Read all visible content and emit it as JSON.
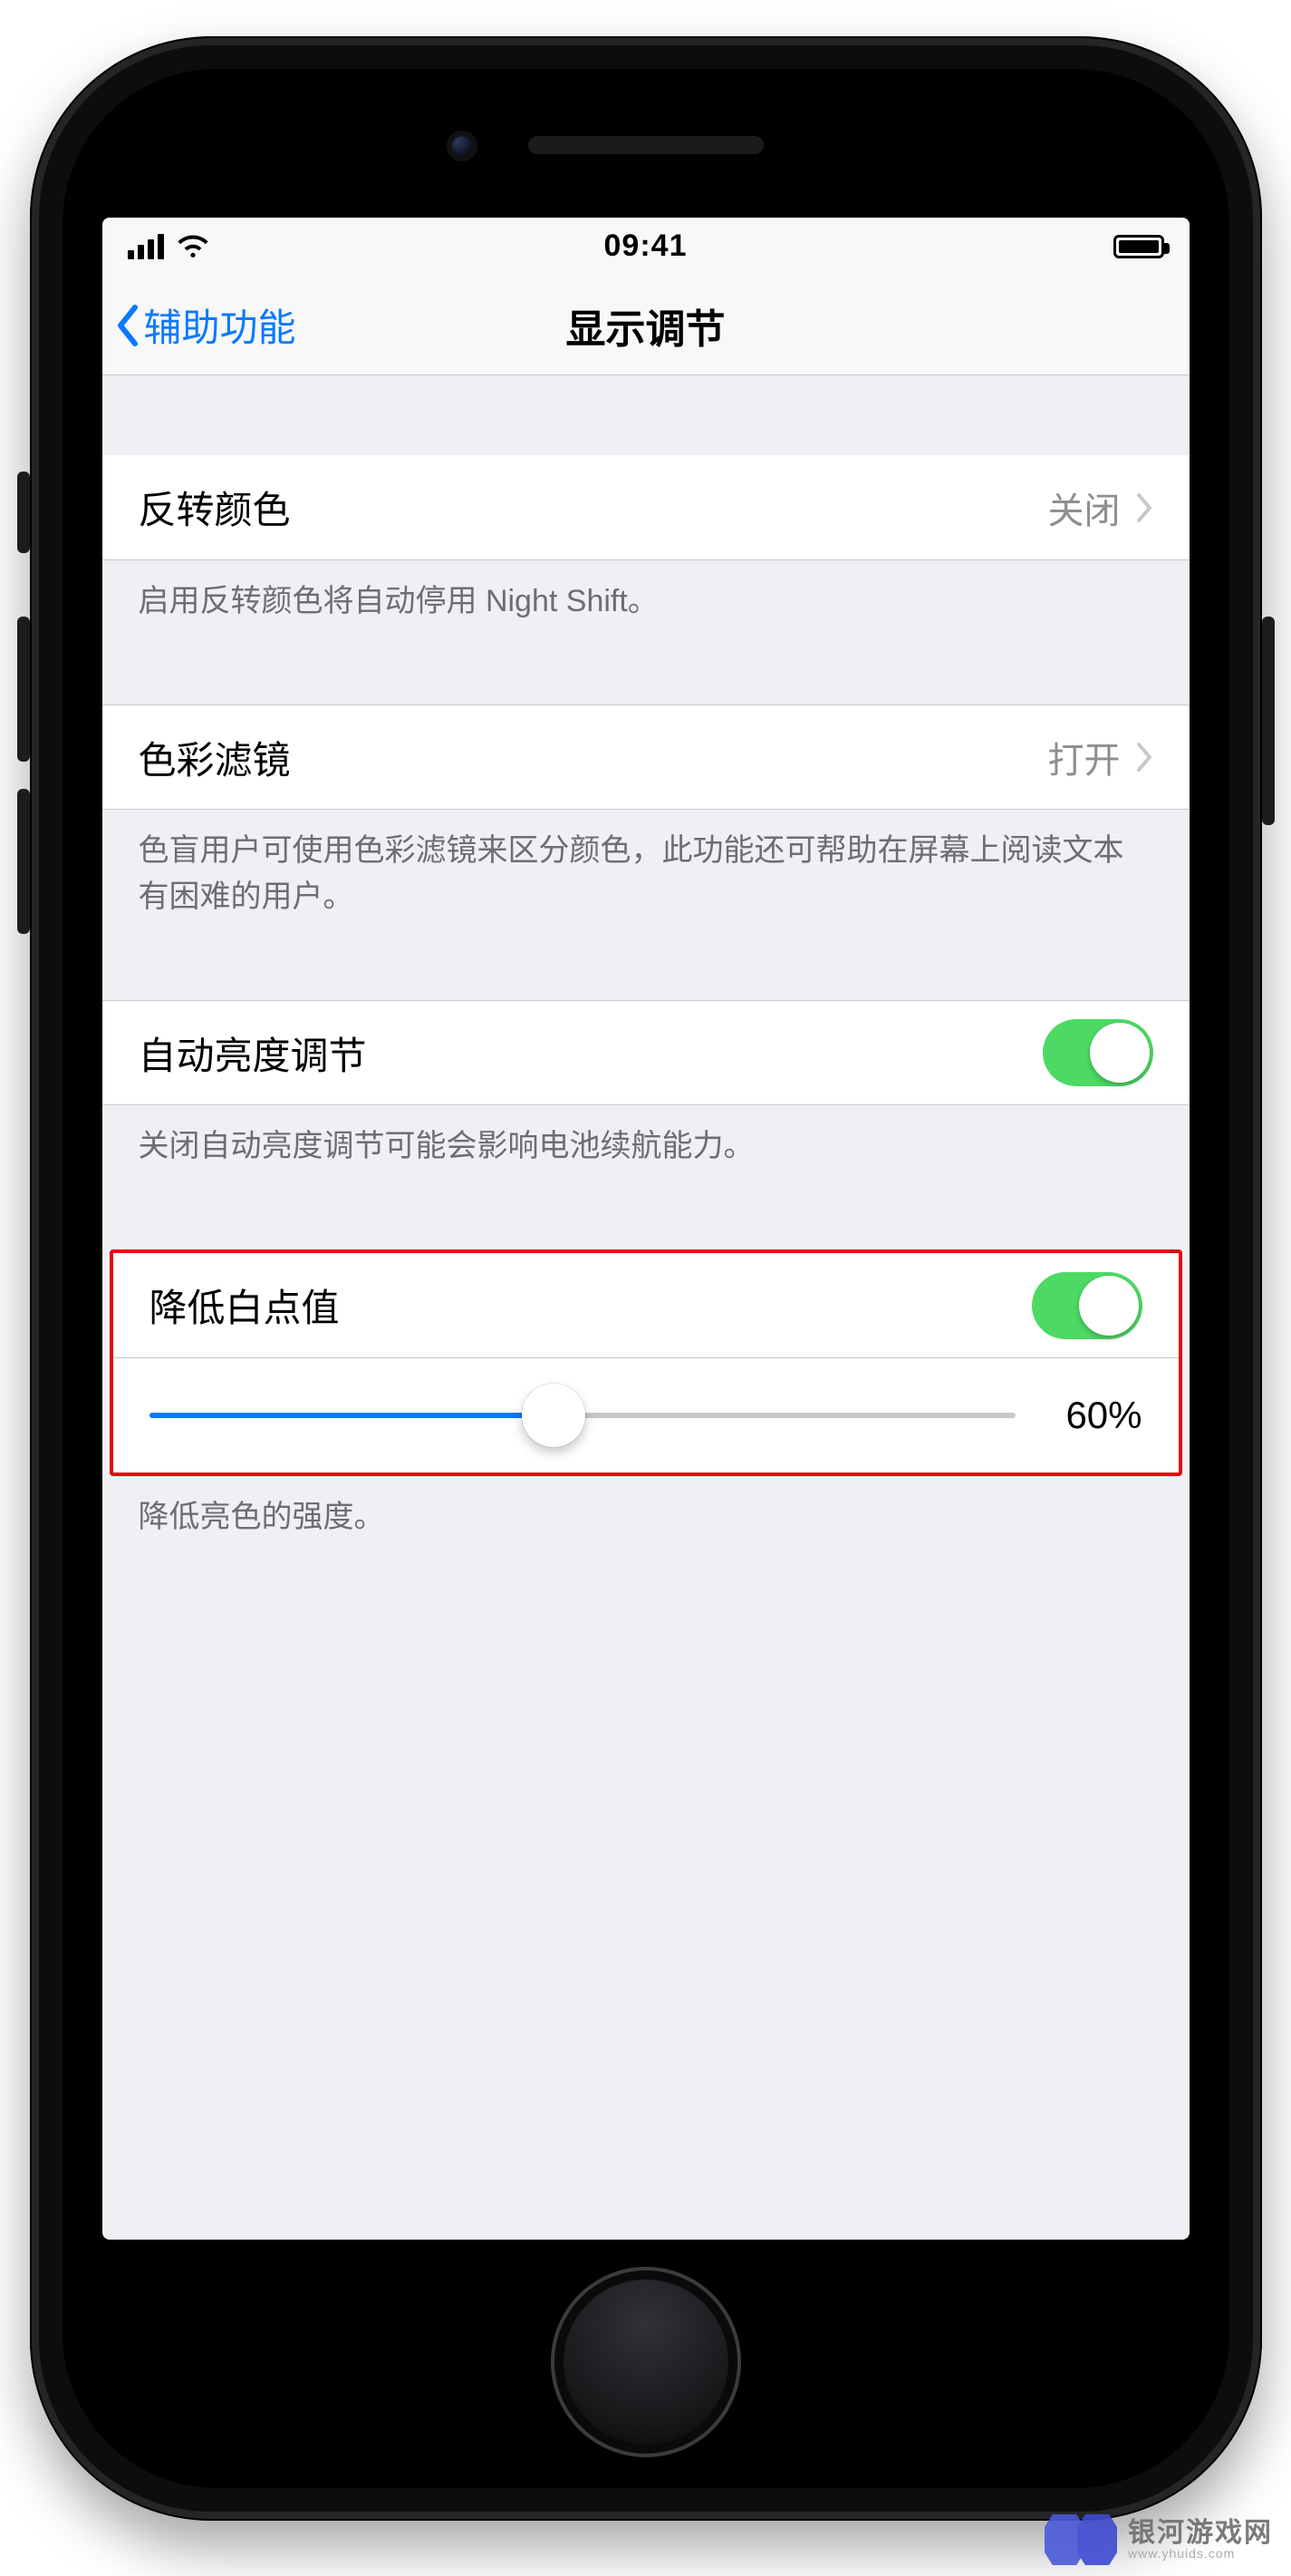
{
  "status": {
    "time": "09:41"
  },
  "nav": {
    "back_label": "辅助功能",
    "title": "显示调节"
  },
  "sections": {
    "invert": {
      "label": "反转颜色",
      "value": "关闭",
      "note": "启用反转颜色将自动停用 Night Shift。"
    },
    "filter": {
      "label": "色彩滤镜",
      "value": "打开",
      "note": "色盲用户可使用色彩滤镜来区分颜色，此功能还可帮助在屏幕上阅读文本有困难的用户。"
    },
    "autoBrightness": {
      "label": "自动亮度调节",
      "on": true,
      "note": "关闭自动亮度调节可能会影响电池续航能力。"
    },
    "whitePoint": {
      "label": "降低白点值",
      "on": true,
      "slider_percent": 60,
      "value_text": "60%",
      "note": "降低亮色的强度。"
    }
  },
  "watermark": {
    "name": "银河游戏网",
    "url": "www.yhuids.com"
  },
  "colors": {
    "accent": "#0a7aff",
    "toggle": "#4cd964",
    "highlight": "#e60012"
  }
}
